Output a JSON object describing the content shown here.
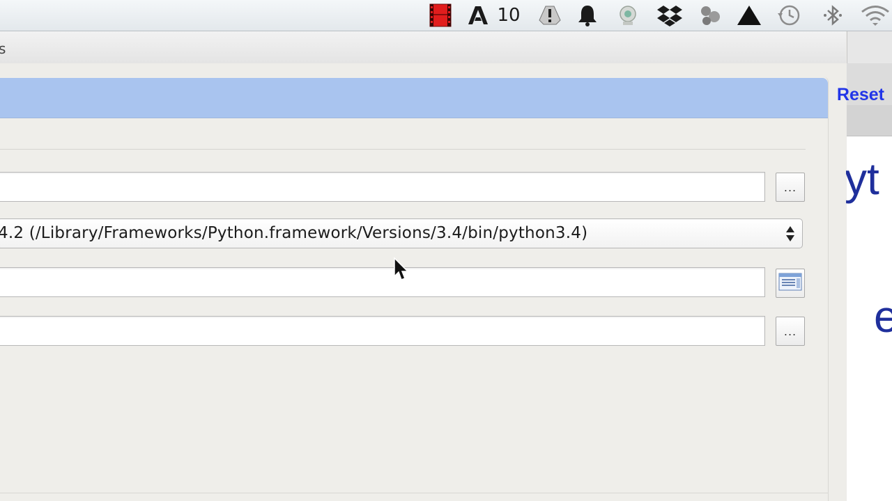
{
  "menubar": {
    "badge_text": "10",
    "icons": [
      "film-icon",
      "adobe-icon",
      "drive-icon",
      "bell-icon",
      "webcam-icon",
      "dropbox-icon",
      "app-icon",
      "google-drive-icon",
      "time-machine-icon",
      "bluetooth-icon",
      "wifi-icon"
    ]
  },
  "window": {
    "title_fragment": "s"
  },
  "panel": {
    "reset_label": "Reset",
    "interpreter_value": "4.2 (/Library/Frameworks/Python.framework/Versions/3.4/bin/python3.4)",
    "field1_value": "",
    "field3_value": "",
    "field4_value": "",
    "browse_label": "..."
  },
  "background_window": {
    "text1": "yt",
    "text2": "e"
  },
  "colors": {
    "header_bar": "#a9c4ef",
    "reset_link": "#2235e8",
    "bg_text": "#1f2f9c"
  }
}
